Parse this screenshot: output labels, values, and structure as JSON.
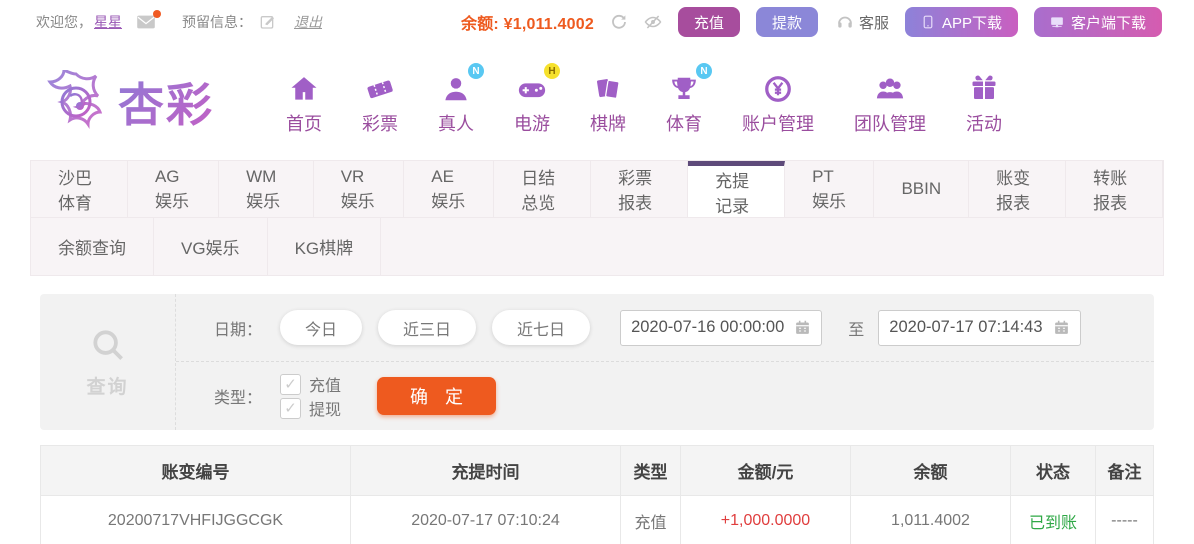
{
  "colors": {
    "accent": "#9a4d9e",
    "icon": "#a05fc6",
    "link": "#9a59b5",
    "active_tab": "#5e4a7a",
    "magenta_btn": "#a74d9d",
    "purple_btn": "#8b87d8",
    "grad1": "#8d82d9",
    "grad2": "#c95fc0",
    "orange": "#ee5a1f",
    "red": "#e03e3e",
    "green": "#2fa846"
  },
  "topbar": {
    "welcome_prefix": "欢迎您，",
    "username": "星星",
    "reserved_label": "预留信息：",
    "logout_label": "退出",
    "balance_label": "余额:",
    "balance_value": "¥1,011.4002",
    "recharge_label": "充值",
    "withdraw_label": "提款",
    "service_label": "客服",
    "app_download_label": "APP下载",
    "client_download_label": "客户端下载"
  },
  "logo": {
    "text": "杏彩"
  },
  "nav": {
    "items": [
      {
        "id": "home",
        "label": "首页",
        "icon": "home-icon",
        "badge": null
      },
      {
        "id": "lottery",
        "label": "彩票",
        "icon": "ticket-icon",
        "badge": null
      },
      {
        "id": "live",
        "label": "真人",
        "icon": "person-icon",
        "badge": {
          "text": "N",
          "color": "blue"
        }
      },
      {
        "id": "egames",
        "label": "电游",
        "icon": "gamepad-icon",
        "badge": {
          "text": "H",
          "color": "yellow"
        }
      },
      {
        "id": "boardgames",
        "label": "棋牌",
        "icon": "cards-icon",
        "badge": null
      },
      {
        "id": "sports",
        "label": "体育",
        "icon": "trophy-icon",
        "badge": {
          "text": "N",
          "color": "blue"
        }
      },
      {
        "id": "account",
        "label": "账户管理",
        "icon": "coin-icon",
        "badge": null
      },
      {
        "id": "team",
        "label": "团队管理",
        "icon": "team-icon",
        "badge": null
      },
      {
        "id": "promo",
        "label": "活动",
        "icon": "gift-icon",
        "badge": null
      }
    ]
  },
  "tabs": {
    "active": "充提记录",
    "row1": [
      "沙巴体育",
      "AG娱乐",
      "WM娱乐",
      "VR娱乐",
      "AE娱乐",
      "日结总览",
      "彩票报表",
      "充提记录",
      "PT娱乐",
      "BBIN",
      "账变报表",
      "转账报表"
    ],
    "row2": [
      "余额查询",
      "VG娱乐",
      "KG棋牌"
    ]
  },
  "filter": {
    "query_label": "查询",
    "date_label": "日期：",
    "date_presets": [
      "今日",
      "近三日",
      "近七日"
    ],
    "date_from": "2020-07-16 00:00:00",
    "to_label": "至",
    "date_to": "2020-07-17 07:14:43",
    "type_label": "类型：",
    "type_options": [
      "充值",
      "提现"
    ],
    "confirm_label": "确 定"
  },
  "table": {
    "headers": [
      "账变编号",
      "充提时间",
      "类型",
      "金额/元",
      "余额",
      "状态",
      "备注"
    ],
    "rows": [
      [
        "20200717VHFIJGGCGK",
        "2020-07-17 07:10:24",
        "充值",
        "+1,000.0000",
        "1,011.4002",
        "已到账",
        "-----"
      ]
    ]
  }
}
